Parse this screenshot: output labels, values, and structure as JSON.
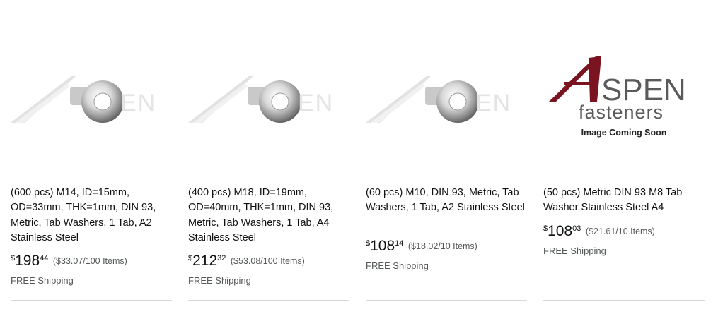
{
  "colors": {
    "title_text": "#0f1111",
    "secondary_text": "#565959",
    "logo_red": "#7a1420",
    "logo_gray": "#555555",
    "divider": "#d5d9d9"
  },
  "products": [
    {
      "image_icon": "aspen-washer-logo-icon",
      "title": "(600 pcs) M14, ID=15mm, OD=33mm, THK=1mm, DIN 93, Metric, Tab Washers, 1 Tab, A2 Stainless Steel",
      "price": {
        "symbol": "$",
        "whole": "198",
        "fraction": "44"
      },
      "unit_price": "($33.07/100 Items)",
      "shipping": "FREE Shipping"
    },
    {
      "image_icon": "aspen-washer-logo-icon",
      "title": "(400 pcs) M18, ID=19mm, OD=40mm, THK=1mm, DIN 93, Metric, Tab Washers, 1 Tab, A4 Stainless Steel",
      "price": {
        "symbol": "$",
        "whole": "212",
        "fraction": "32"
      },
      "unit_price": "($53.08/100 Items)",
      "shipping": "FREE Shipping"
    },
    {
      "image_icon": "aspen-washer-logo-icon",
      "title": "(60 pcs) M10, DIN 93, Metric, Tab Washers, 1 Tab, A2 Stainless Steel",
      "price": {
        "symbol": "$",
        "whole": "108",
        "fraction": "14"
      },
      "unit_price": "($18.02/10 Items)",
      "shipping": "FREE Shipping"
    },
    {
      "image_icon": "aspen-fasteners-logo-icon",
      "image_logo_text": {
        "big_a": "A",
        "word": "SPEN",
        "sub": "fasteners",
        "caption": "Image Coming Soon"
      },
      "title": "(50 pcs) Metric DIN 93 M8 Tab Washer Stainless Steel A4",
      "price": {
        "symbol": "$",
        "whole": "108",
        "fraction": "03"
      },
      "unit_price": "($21.61/10 Items)",
      "shipping": "FREE Shipping"
    }
  ]
}
